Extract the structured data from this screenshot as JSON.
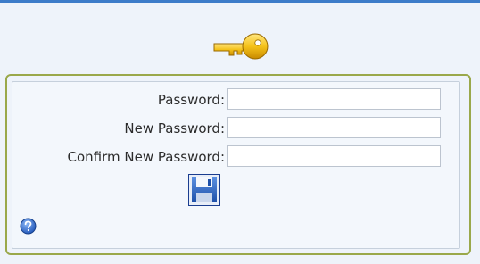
{
  "form": {
    "fields": [
      {
        "label": "Password:",
        "value": ""
      },
      {
        "label": "New Password:",
        "value": ""
      },
      {
        "label": "Confirm New Password:",
        "value": ""
      }
    ]
  },
  "icons": {
    "header": "key-icon",
    "save": "floppy-disk-icon",
    "help": "question-mark-icon"
  },
  "colors": {
    "top_border": "#3d7cc9",
    "panel_border": "#9aa84a",
    "background": "#eef3fa",
    "key_gold": "#f5c21a"
  }
}
